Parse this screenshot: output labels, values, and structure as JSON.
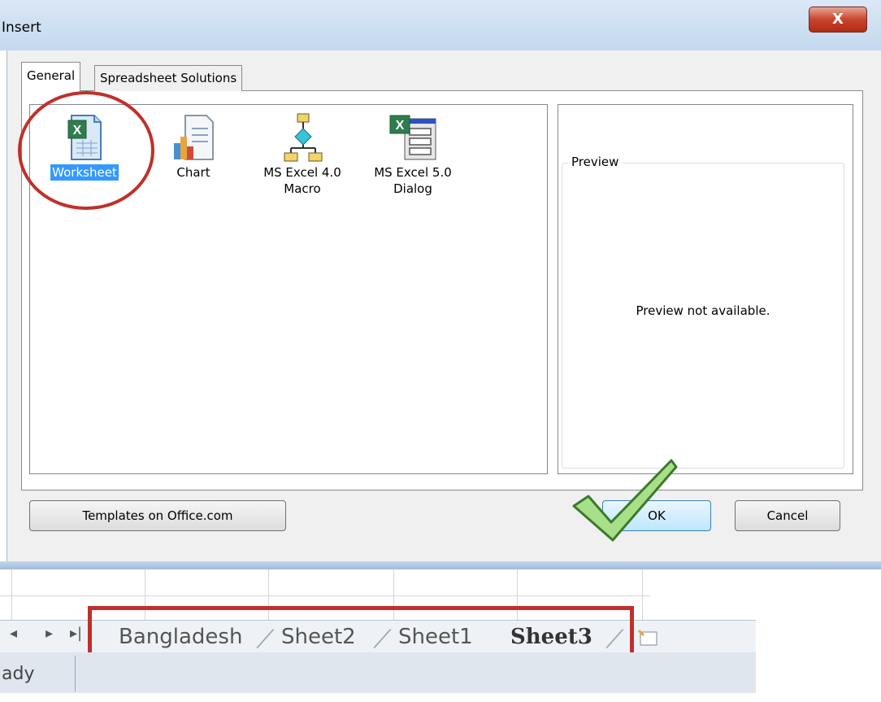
{
  "window": {
    "title": "Insert",
    "close_label": "X"
  },
  "tabs": [
    {
      "label": "General"
    },
    {
      "label": "Spreadsheet Solutions"
    }
  ],
  "items": [
    {
      "label": "Worksheet",
      "icon": "worksheet-icon",
      "selected": true
    },
    {
      "label": "Chart",
      "icon": "chart-icon"
    },
    {
      "label": "MS Excel 4.0\nMacro",
      "icon": "macro-icon"
    },
    {
      "label": "MS Excel 5.0\nDialog",
      "icon": "dialog-icon"
    }
  ],
  "view_buttons": [
    "large-icons-view-icon",
    "list-view-icon",
    "details-view-icon"
  ],
  "preview": {
    "legend": "Preview",
    "message": "Preview not available."
  },
  "buttons": {
    "templates": "Templates on Office.com",
    "ok": "OK",
    "cancel": "Cancel"
  },
  "sheet_tabs": [
    "Bangladesh",
    "Sheet2",
    "Sheet1",
    "Sheet3"
  ],
  "active_sheet": "Sheet3",
  "status": {
    "text": "ady"
  },
  "colors": {
    "annotation_red": "#c0302a",
    "selection_blue": "#3399ff",
    "check_green": "#6fbf4a"
  }
}
